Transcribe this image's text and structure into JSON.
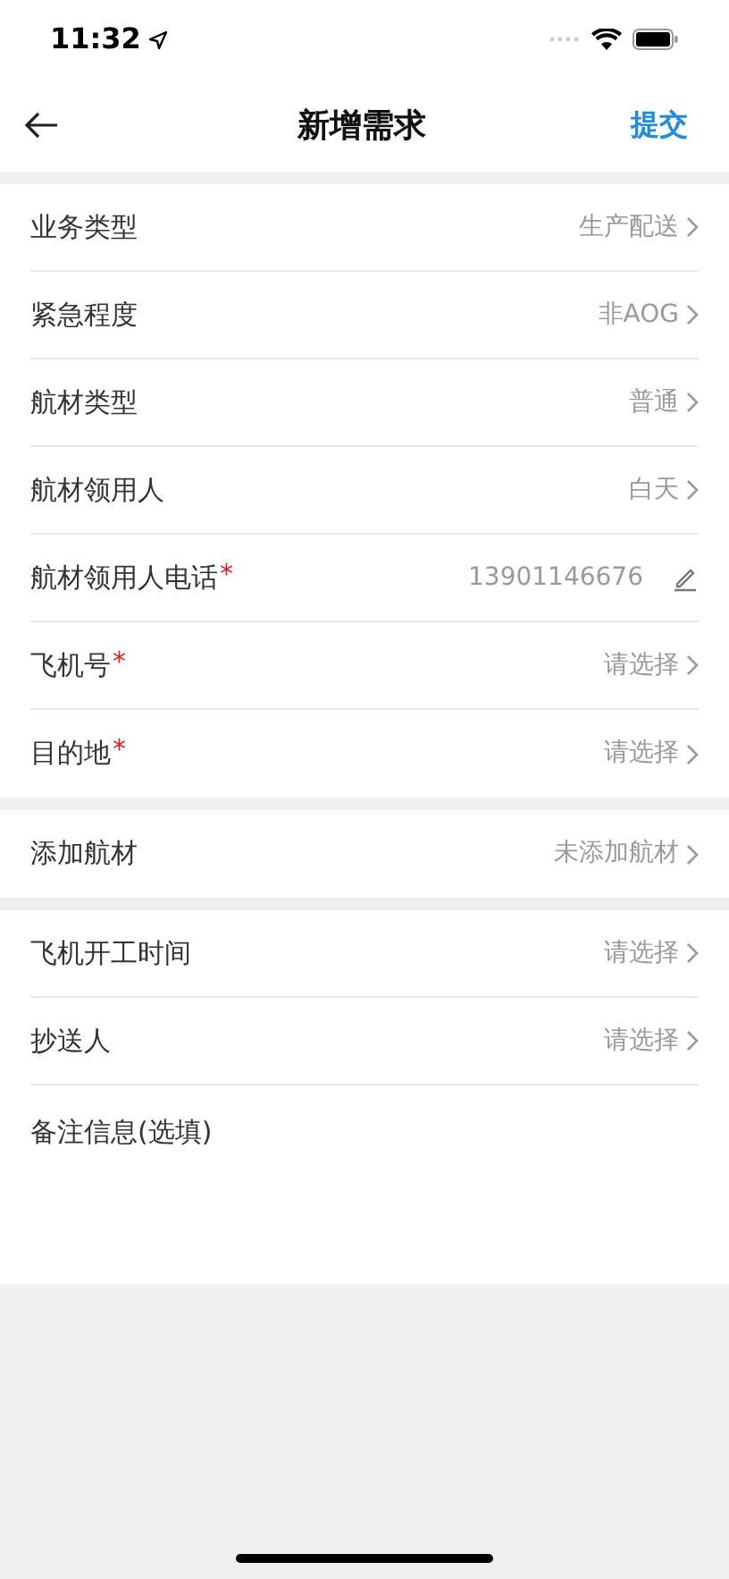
{
  "status_bar": {
    "time": "11:32"
  },
  "nav": {
    "title": "新增需求",
    "action": "提交"
  },
  "sections": [
    {
      "rows": [
        {
          "label": "业务类型",
          "value": "生产配送",
          "kind": "select"
        },
        {
          "label": "紧急程度",
          "value": "非AOG",
          "kind": "select"
        },
        {
          "label": "航材类型",
          "value": "普通",
          "kind": "select"
        },
        {
          "label": "航材领用人",
          "value": "白天",
          "kind": "select"
        },
        {
          "label": "航材领用人电话",
          "required_mark": "*",
          "value": "13901146676",
          "kind": "edit"
        },
        {
          "label": "飞机号",
          "required_mark": "*",
          "value": "请选择",
          "kind": "select"
        },
        {
          "label": "目的地",
          "required_mark": "*",
          "value": "请选择",
          "kind": "select"
        }
      ]
    },
    {
      "rows": [
        {
          "label": "添加航材",
          "value": "未添加航材",
          "kind": "select"
        }
      ]
    },
    {
      "rows": [
        {
          "label": "飞机开工时间",
          "value": "请选择",
          "kind": "select"
        },
        {
          "label": "抄送人",
          "value": "请选择",
          "kind": "select"
        },
        {
          "label": "备注信息(选填)",
          "kind": "textarea"
        }
      ]
    }
  ]
}
